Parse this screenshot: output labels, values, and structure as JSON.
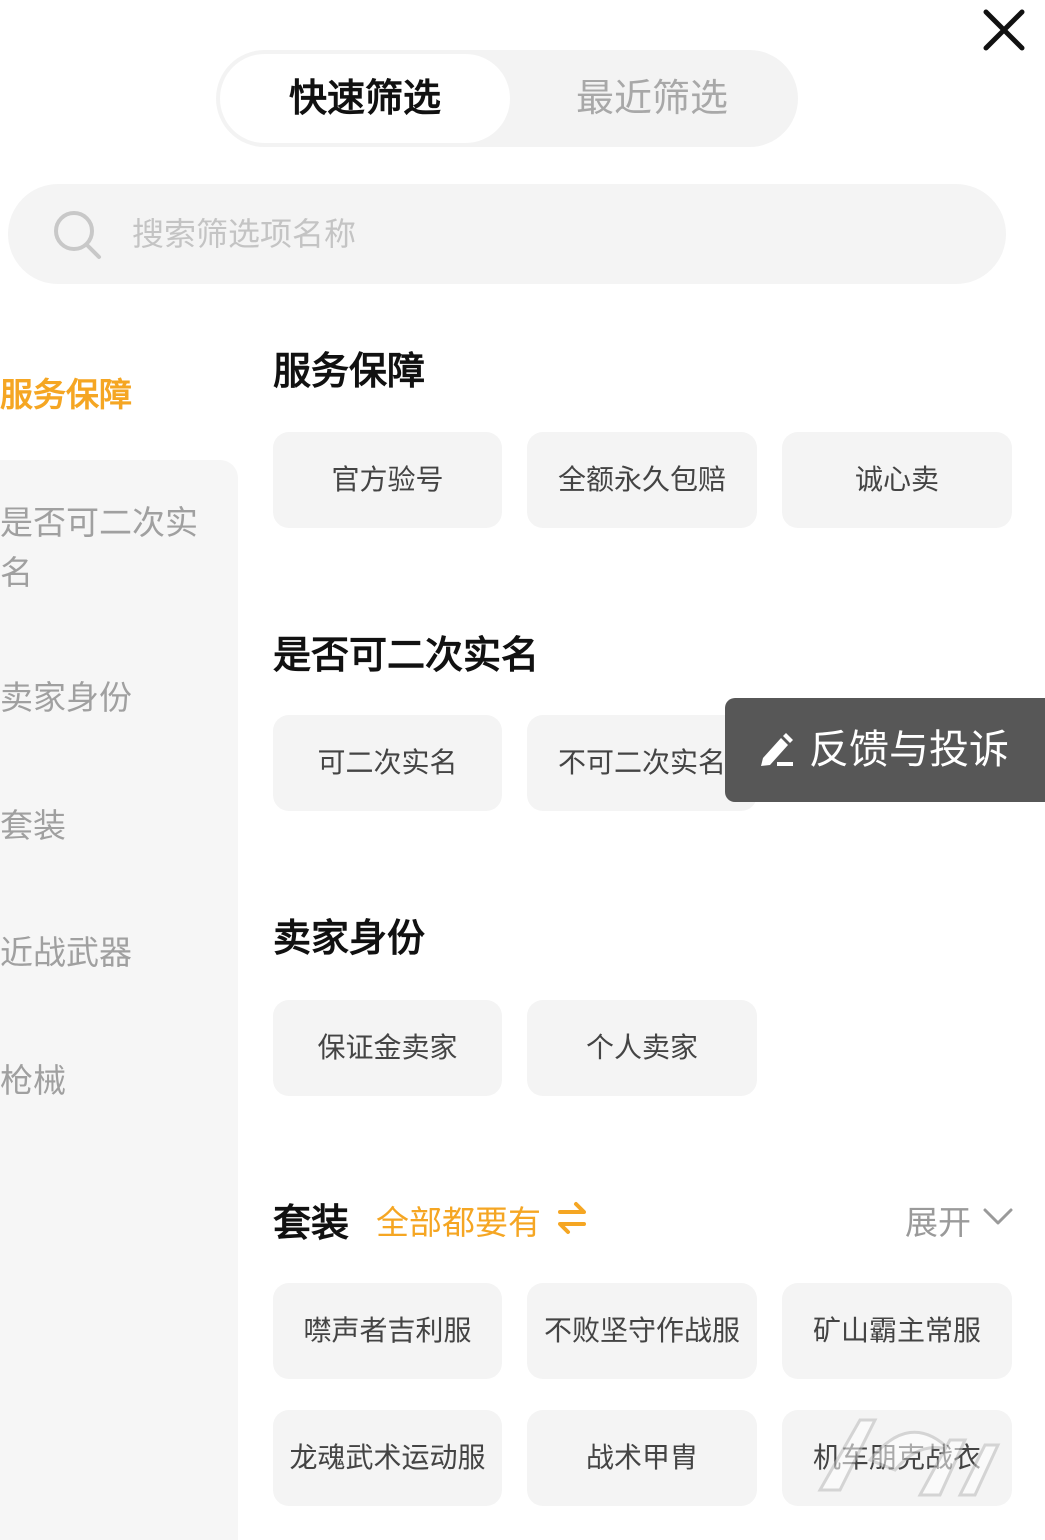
{
  "tabs": {
    "quick": "快速筛选",
    "recent": "最近筛选"
  },
  "search": {
    "placeholder": "搜索筛选项名称"
  },
  "sidebar": {
    "items": [
      {
        "label": "服务保障",
        "active": true
      },
      {
        "label": "是否可二次实名",
        "active": false
      },
      {
        "label": "卖家身份",
        "active": false
      },
      {
        "label": "套装",
        "active": false
      },
      {
        "label": "近战武器",
        "active": false
      },
      {
        "label": "枪械",
        "active": false
      }
    ]
  },
  "sections": {
    "service": {
      "title": "服务保障",
      "options": [
        "官方验号",
        "全额永久包赔",
        "诚心卖"
      ]
    },
    "realname": {
      "title": "是否可二次实名",
      "options": [
        "可二次实名",
        "不可二次实名"
      ]
    },
    "seller": {
      "title": "卖家身份",
      "options": [
        "保证金卖家",
        "个人卖家"
      ]
    },
    "outfit": {
      "title": "套装",
      "match_mode": "全部都要有",
      "expand_label": "展开",
      "options": [
        "噤声者吉利服",
        "不败坚守作战服",
        "矿山霸主常服",
        "龙魂武术运动服",
        "战术甲胄",
        "机车朋克战衣"
      ]
    }
  },
  "feedback": {
    "label": "反馈与投诉"
  },
  "colors": {
    "accent": "#f5a623",
    "chip_bg": "#f4f4f4",
    "feedback_bg": "#575757"
  },
  "icons": {
    "close": "close-icon",
    "search": "search-icon",
    "swap": "swap-icon",
    "chevron": "chevron-down-icon",
    "edit": "edit-icon"
  }
}
